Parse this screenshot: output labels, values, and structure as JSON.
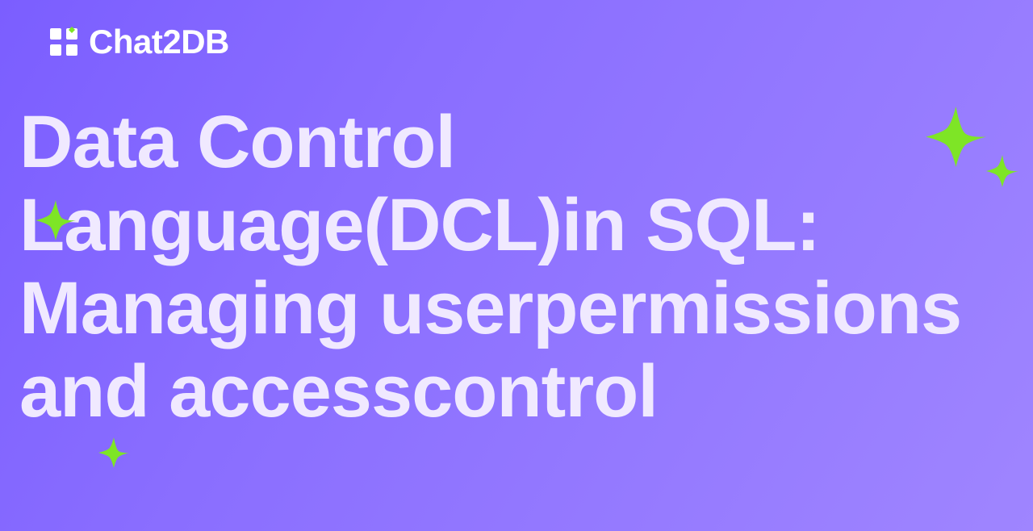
{
  "brand": {
    "name": "Chat2DB"
  },
  "heading": "Data Control Language(DCL)in SQL: Managing userpermissions and accesscontrol"
}
